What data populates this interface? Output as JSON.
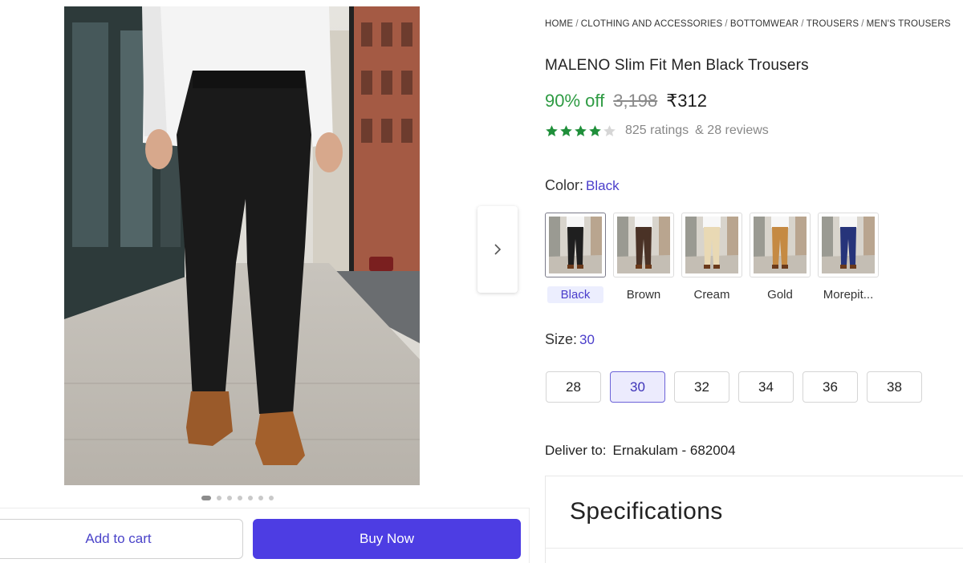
{
  "breadcrumb": [
    "HOME",
    "CLOTHING AND ACCESSORIES",
    "BOTTOMWEAR",
    "TROUSERS",
    "MEN'S TROUSERS"
  ],
  "product": {
    "title": "MALENO Slim Fit Men Black Trousers",
    "discount": "90% off",
    "mrp": "3,198",
    "price": "₹312",
    "rating_value": 4,
    "ratings_text": "825 ratings",
    "reviews_text": "& 28 reviews"
  },
  "color": {
    "label": "Color:",
    "selected": "Black",
    "options": [
      {
        "label": "Black",
        "pant": "#1f1f1f"
      },
      {
        "label": "Brown",
        "pant": "#4a3226"
      },
      {
        "label": "Cream",
        "pant": "#e9d9b4"
      },
      {
        "label": "Gold",
        "pant": "#c58a43"
      },
      {
        "label": "Morepit...",
        "pant": "#26347a"
      }
    ]
  },
  "size": {
    "label": "Size:",
    "selected": "30",
    "options": [
      "28",
      "30",
      "32",
      "34",
      "36",
      "38"
    ]
  },
  "delivery": {
    "label": "Deliver to:",
    "location": "Ernakulam - 682004"
  },
  "specifications": {
    "title": "Specifications"
  },
  "gallery": {
    "image_count": 7,
    "active_index": 0
  },
  "actions": {
    "add_to_cart": "Add to cart",
    "buy_now": "Buy Now"
  },
  "colors": {
    "accent": "#4d3de3",
    "discount_green": "#2e9b43",
    "star_green": "#1f8f3a"
  }
}
